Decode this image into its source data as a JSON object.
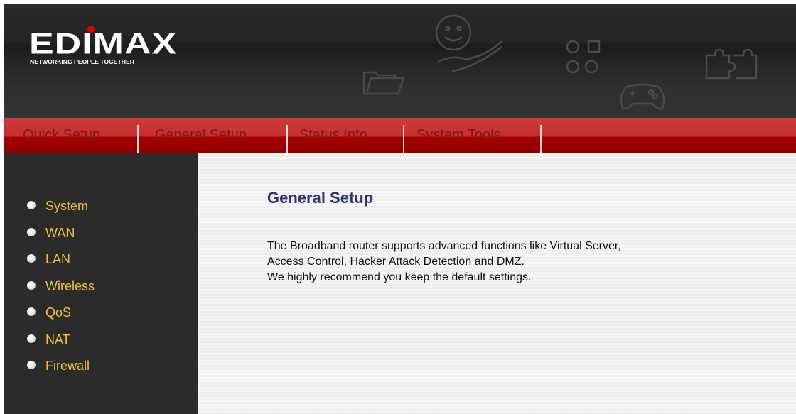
{
  "header": {
    "logo_text": "EDIMAX",
    "tagline": "NETWORKING PEOPLE TOGETHER"
  },
  "nav": {
    "items": [
      {
        "label": "Quick Setup"
      },
      {
        "label": "General Setup"
      },
      {
        "label": "Status Info"
      },
      {
        "label": "System Tools"
      }
    ]
  },
  "sidebar": {
    "items": [
      {
        "label": "System"
      },
      {
        "label": "WAN"
      },
      {
        "label": "LAN"
      },
      {
        "label": "Wireless"
      },
      {
        "label": "QoS"
      },
      {
        "label": "NAT"
      },
      {
        "label": "Firewall"
      }
    ]
  },
  "main": {
    "title": "General Setup",
    "description_lines": [
      "The Broadband router supports advanced functions like Virtual Server,",
      "Access Control, Hacker Attack Detection and DMZ.",
      "We highly recommend you keep the default settings."
    ]
  },
  "colors": {
    "nav_bar": "#b01818",
    "nav_text": "#8a1414",
    "sidebar_bg": "#2b2b2b",
    "sidebar_text": "#f0c040",
    "title_text": "#2e3670"
  },
  "icons": {
    "header_decorations": [
      "folder-icon",
      "smiley-hand-icon",
      "circles-squares-icon",
      "gamepad-icon",
      "puzzle-icon"
    ],
    "sidebar_bullet": "radio-bullet-icon"
  }
}
